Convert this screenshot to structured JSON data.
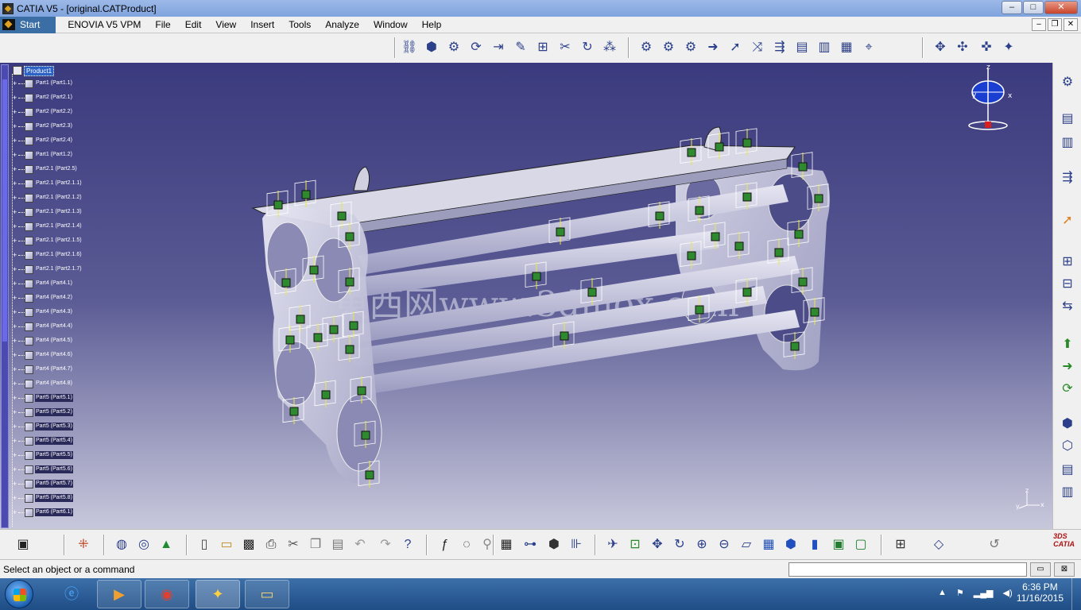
{
  "window": {
    "title": "CATIA V5 - [original.CATProduct]",
    "min": "–",
    "max": "□",
    "close": "✕"
  },
  "menu": {
    "start": "Start",
    "items": [
      "ENOVIA V5 VPM",
      "File",
      "Edit",
      "View",
      "Insert",
      "Tools",
      "Analyze",
      "Window",
      "Help"
    ],
    "mdi": [
      "–",
      "❐",
      "✕"
    ]
  },
  "tree": {
    "root": "Product1",
    "items": [
      "Part1 (Part1.1)",
      "Part2 (Part2.1)",
      "Part2 (Part2.2)",
      "Part2 (Part2.3)",
      "Part2 (Part2.4)",
      "Part1 (Part1.2)",
      "Part2.1 (Part2.5)",
      "Part2.1 (Part2.1.1)",
      "Part2.1 (Part2.1.2)",
      "Part2.1 (Part2.1.3)",
      "Part2.1 (Part2.1.4)",
      "Part2.1 (Part2.1.5)",
      "Part2.1 (Part2.1.6)",
      "Part2.1 (Part2.1.7)",
      "Part4 (Part4.1)",
      "Part4 (Part4.2)",
      "Part4 (Part4.3)",
      "Part4 (Part4.4)",
      "Part4 (Part4.5)",
      "Part4 (Part4.6)",
      "Part4 (Part4.7)",
      "Part4 (Part4.8)",
      "Part5 (Part5.1)",
      "Part5 (Part5.2)",
      "Part5 (Part5.3)",
      "Part5 (Part5.4)",
      "Part5 (Part5.5)",
      "Part5 (Part5.6)",
      "Part5 (Part5.7)",
      "Part5 (Part5.8)",
      "Part6 (Part6.1)"
    ]
  },
  "watermark": "東西网www.3dmox.com",
  "status": {
    "message": "Select an object or a command",
    "command_value": ""
  },
  "taskbar": {
    "time": "6:36 PM",
    "date": "11/16/2015"
  },
  "icons": {
    "top": [
      "chain-icon",
      "cube-icon",
      "assembly-icon",
      "update-icon",
      "snap-icon",
      "pencil-icon",
      "explode-icon",
      "clash-icon",
      "rotate-icon",
      "grid-icon",
      "gear-icon",
      "gear2-icon",
      "gear3-icon",
      "arrow-icon",
      "arrow2-icon",
      "split-icon",
      "publish-icon",
      "sheet-icon",
      "sheet2-icon",
      "scan-icon",
      "measure-icon",
      "xy-icon",
      "star-icon"
    ],
    "bottom": [
      "camera-icon",
      "grid-icon",
      "sphere-icon",
      "sphere2-icon",
      "tri-icon",
      "new-icon",
      "open-icon",
      "save-icon",
      "print-icon",
      "cut-icon",
      "copy-icon",
      "paste-icon",
      "undo-icon",
      "redo-icon",
      "help-icon",
      "fx-icon",
      "comment-icon",
      "knowledge-icon",
      "table-icon",
      "tree-icon",
      "part-icon",
      "tools-icon",
      "fit-icon",
      "pan-icon",
      "rotate-icon",
      "zoom-in-icon",
      "zoom-out-icon",
      "normal-icon",
      "iso-icon",
      "shading-icon",
      "hide-icon",
      "swap-icon",
      "perspective-icon",
      "bars-icon",
      "pen-icon",
      "refresh-icon"
    ]
  },
  "colors": {
    "viewport_top": "#3a3a7e",
    "viewport_bottom": "#c8c8dc",
    "constraint_green": "#2f8a2f",
    "constraint_yellow": "#e8e84a"
  }
}
